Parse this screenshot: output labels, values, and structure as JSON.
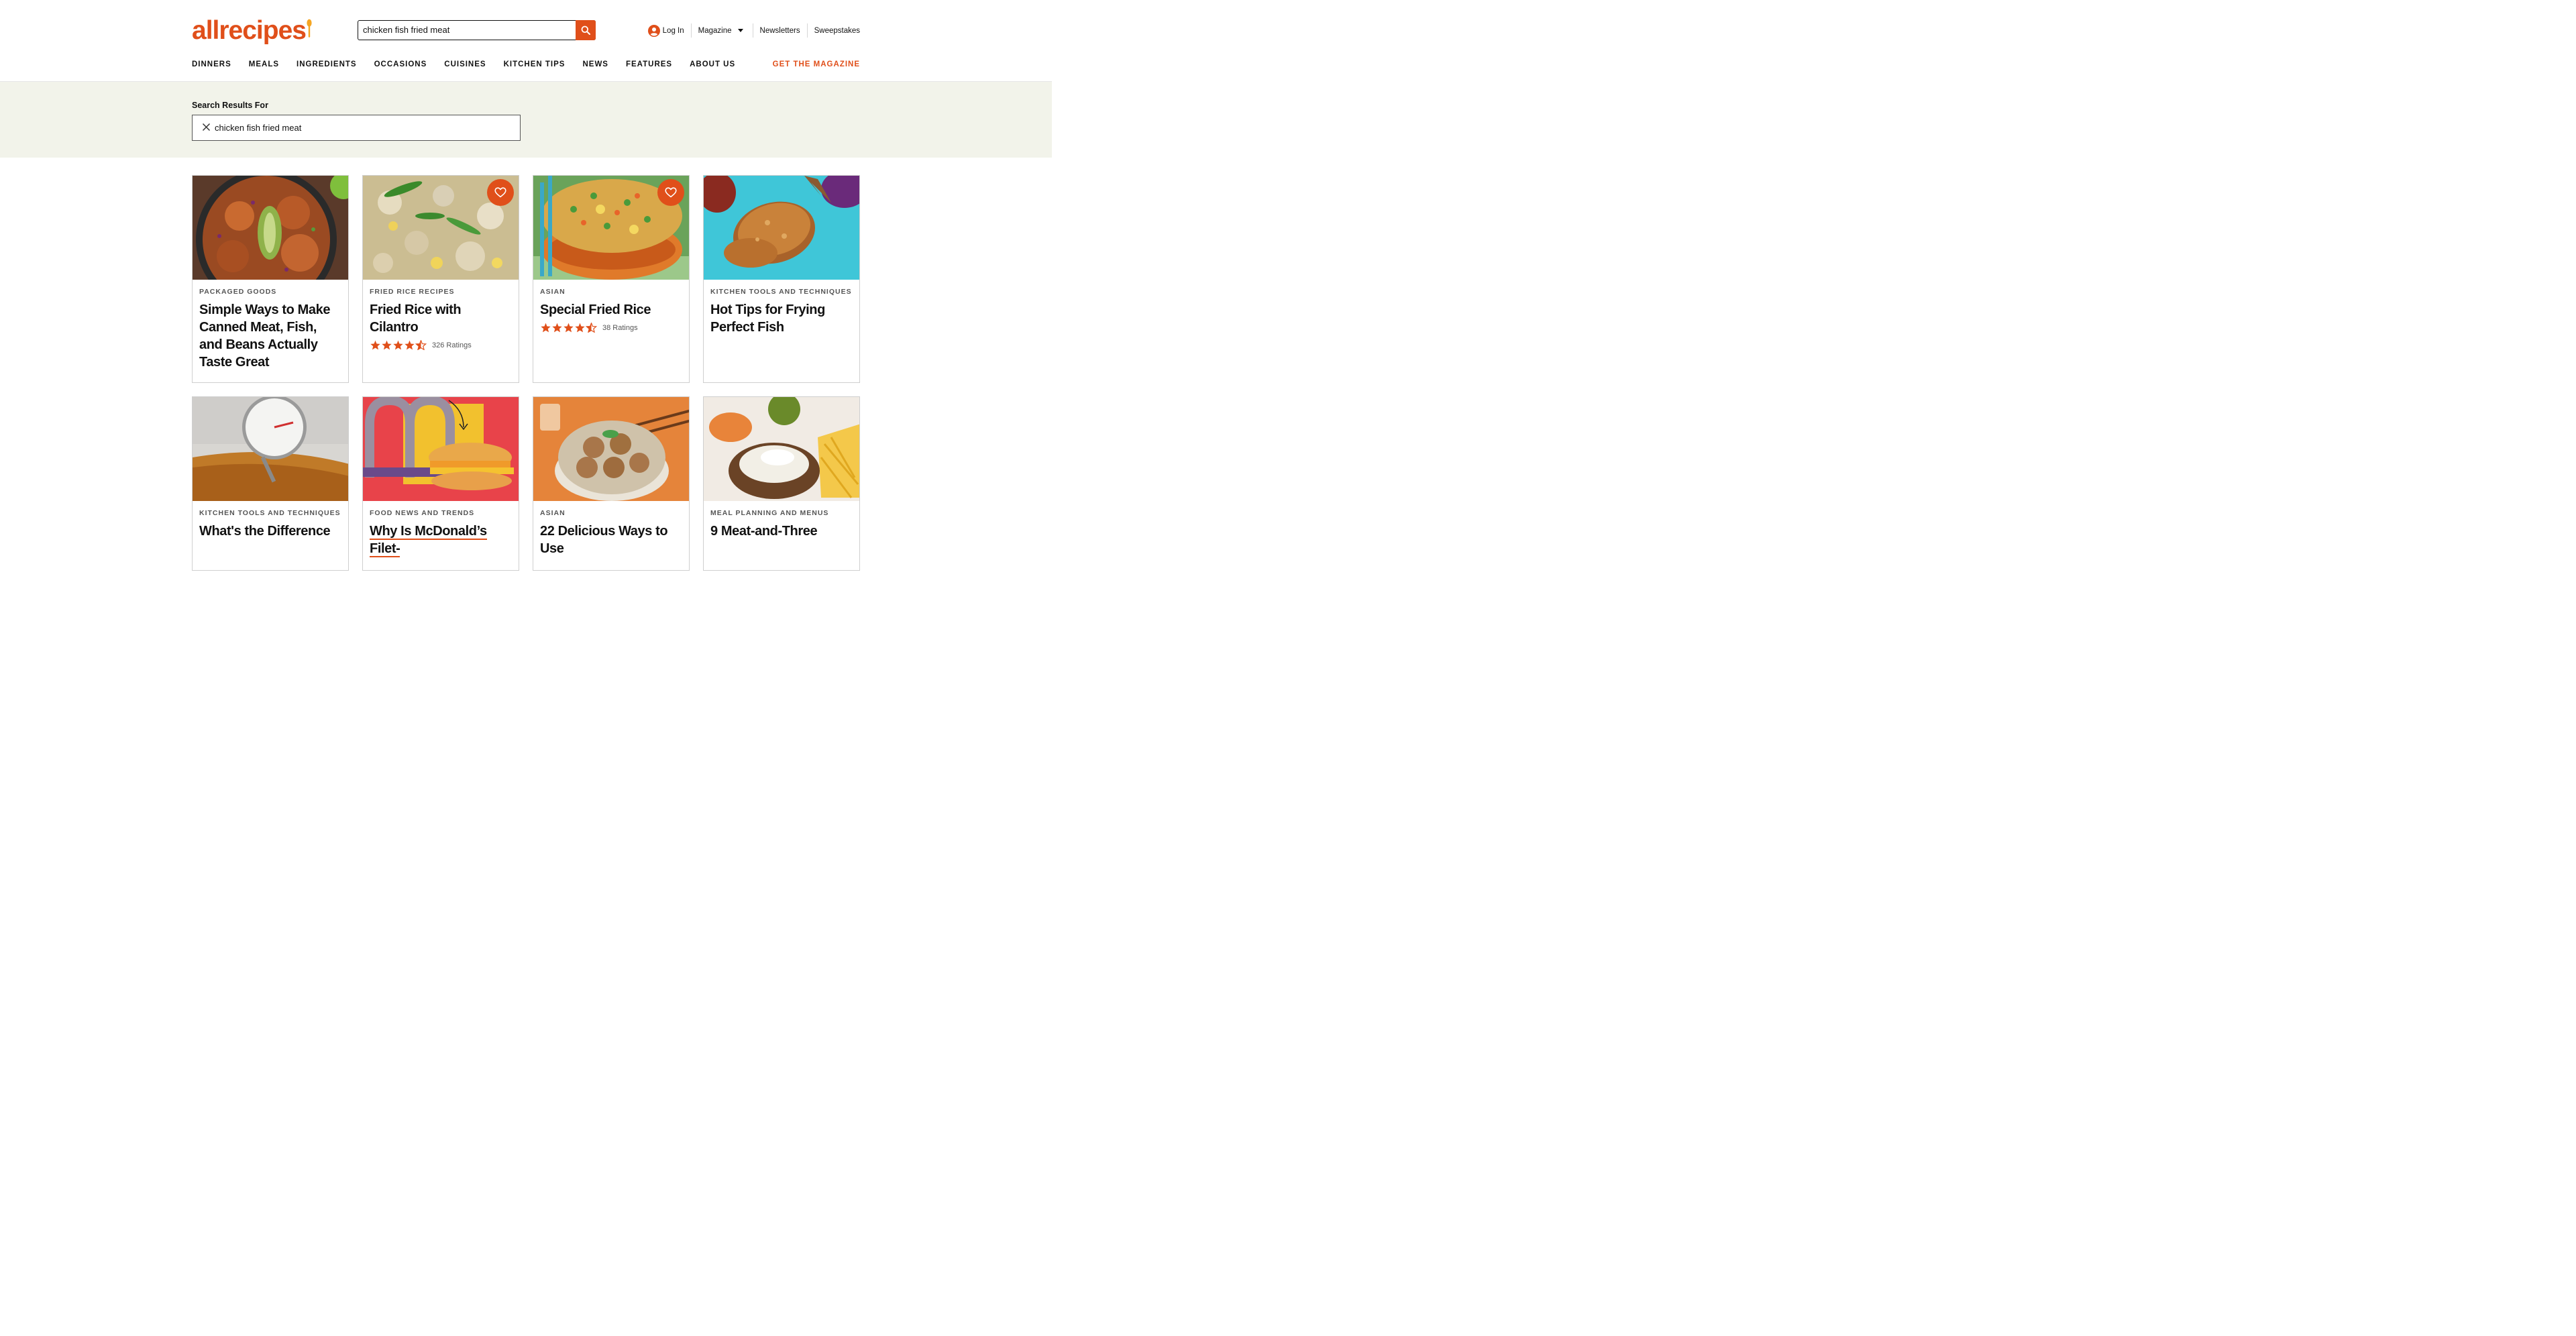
{
  "header": {
    "logo": "allrecipes",
    "search_value": "chicken fish fried meat",
    "login_label": "Log In",
    "magazine_label": "Magazine",
    "newsletters_label": "Newsletters",
    "sweepstakes_label": "Sweepstakes",
    "nav": [
      "DINNERS",
      "MEALS",
      "INGREDIENTS",
      "OCCASIONS",
      "CUISINES",
      "KITCHEN TIPS",
      "NEWS",
      "FEATURES",
      "ABOUT US"
    ],
    "get_magazine": "GET THE MAGAZINE"
  },
  "results": {
    "label": "Search Results For",
    "query": "chicken fish fried meat"
  },
  "cards": [
    {
      "tag": "PACKAGED GOODS",
      "title": "Simple Ways to Make Canned Meat, Fish, and Beans Actually Taste Great"
    },
    {
      "tag": "FRIED RICE RECIPES",
      "title": "Fried Rice with Cilantro",
      "rating": 4.5,
      "ratings_text": "326 Ratings"
    },
    {
      "tag": "ASIAN",
      "title": "Special Fried Rice",
      "rating": 4.5,
      "ratings_text": "38 Ratings"
    },
    {
      "tag": "KITCHEN TOOLS AND TECHNIQUES",
      "title": "Hot Tips for Frying Perfect Fish"
    },
    {
      "tag": "KITCHEN TOOLS AND TECHNIQUES",
      "title": "What's the Difference"
    },
    {
      "tag": "FOOD NEWS AND TRENDS",
      "title": "Why Is McDonald’s Filet-"
    },
    {
      "tag": "ASIAN",
      "title": "22 Delicious Ways to Use"
    },
    {
      "tag": "MEAL PLANNING AND MENUS",
      "title": "9 Meat-and-Three"
    }
  ],
  "colors": {
    "brand": "#e04f1a",
    "band": "#f2f3ea"
  },
  "icons": [
    "search-icon",
    "user-icon",
    "caret-down-icon",
    "close-icon",
    "heart-icon",
    "star-icon"
  ]
}
